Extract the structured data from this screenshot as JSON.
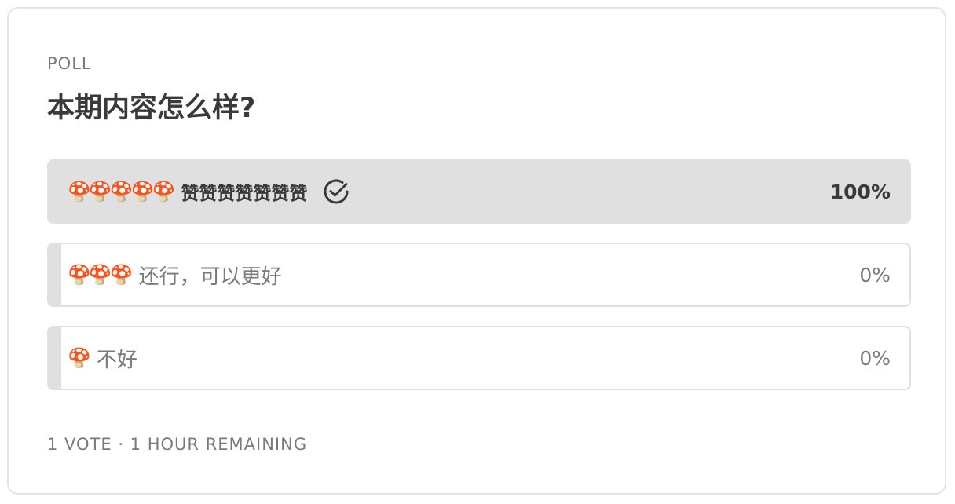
{
  "poll": {
    "label": "POLL",
    "question": "本期内容怎么样?",
    "options": [
      {
        "emoji": "🍄🍄🍄🍄🍄",
        "text": "赞赞赞赞赞赞赞",
        "percent": "100%",
        "fill": 1.0,
        "selected": true
      },
      {
        "emoji": "🍄🍄🍄",
        "text": "还行，可以更好",
        "percent": "0%",
        "fill": 0.0,
        "selected": false
      },
      {
        "emoji": "🍄",
        "text": "不好",
        "percent": "0%",
        "fill": 0.0,
        "selected": false
      }
    ],
    "footer": "1 VOTE · 1 HOUR REMAINING"
  },
  "icons": {
    "selected_marker": "check-circle-icon"
  }
}
